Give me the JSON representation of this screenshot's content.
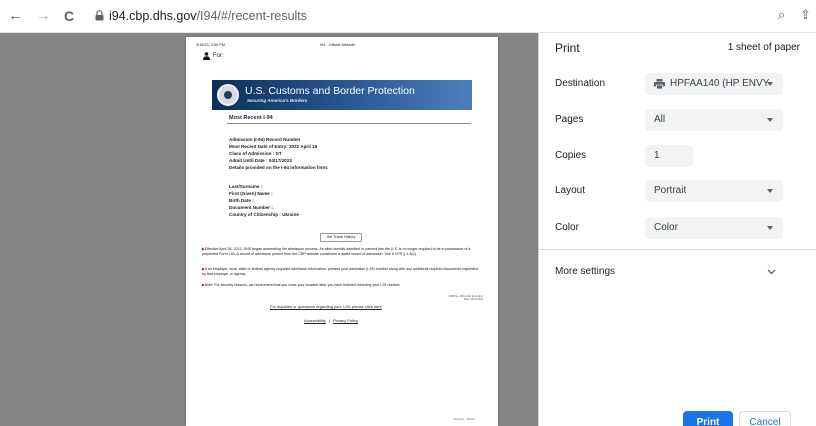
{
  "browser": {
    "url_host": "i94.cbp.dhs.gov",
    "url_path": "/I94/#/recent-results",
    "back_glyph": "←",
    "forward_glyph": "→",
    "reload_glyph": "C",
    "zoom_glyph": "⌕",
    "share_glyph": "⇪"
  },
  "preview": {
    "header_left": "3/15/23, 3:50 PM",
    "header_center": "I94 - Official Website",
    "for_label": "For:",
    "banner_title": "U.S. Customs and Border Protection",
    "banner_subtitle": "Securing America's Borders",
    "section_title": "Most Recent I-94",
    "record_lines": [
      "Admission (I-94) Record Number",
      "Most Recent Date of Entry: 2022 April 18",
      "Class of Admission : DT",
      "Admit Until Date : 04/17/2023",
      "Details provided on the I-94 information form:"
    ],
    "person_lines": [
      "Last/Surname :",
      "First (Given) Name :",
      "Birth Date :",
      "Document Number :",
      "Country of Citizenship :   Ukraine"
    ],
    "travel_history_button": "Get Travel History",
    "notices": [
      "Effective April 26, 2013, DHS began automating the admission process. An alien lawfully admitted or paroled into the U.S. is no longer required to be in possession of a preprinted Form I-94. A record of admission printed from the CBP website constitutes a lawful record of admission. See 8 CFR § 1.4(d).",
      "If an employer, local, state or federal agency requests admission information, present your admission (I-94) number along with any additional required documents requested by that employer or agency.",
      "Note: For security reasons, we recommend that you close your browser after you have finished retrieving your I-94 number."
    ],
    "tiny_right": "OMB No. 1651-0111 Expiration Date: 08/31/2024",
    "inquiries_link": "For inquiries or questions regarding your I-94, please click here",
    "accessibility_link": "Accessibility",
    "privacy_link": "Privacy Policy",
    "footer_right": "Privacy - Terms"
  },
  "print": {
    "title": "Print",
    "sheets": "1 sheet of paper",
    "destination_label": "Destination",
    "destination_value": "HPFAA140 (HP ENVY",
    "pages_label": "Pages",
    "pages_value": "All",
    "copies_label": "Copies",
    "copies_value": "1",
    "layout_label": "Layout",
    "layout_value": "Portrait",
    "color_label": "Color",
    "color_value": "Color",
    "more_settings": "More settings",
    "print_button": "Print",
    "cancel_button": "Cancel"
  }
}
